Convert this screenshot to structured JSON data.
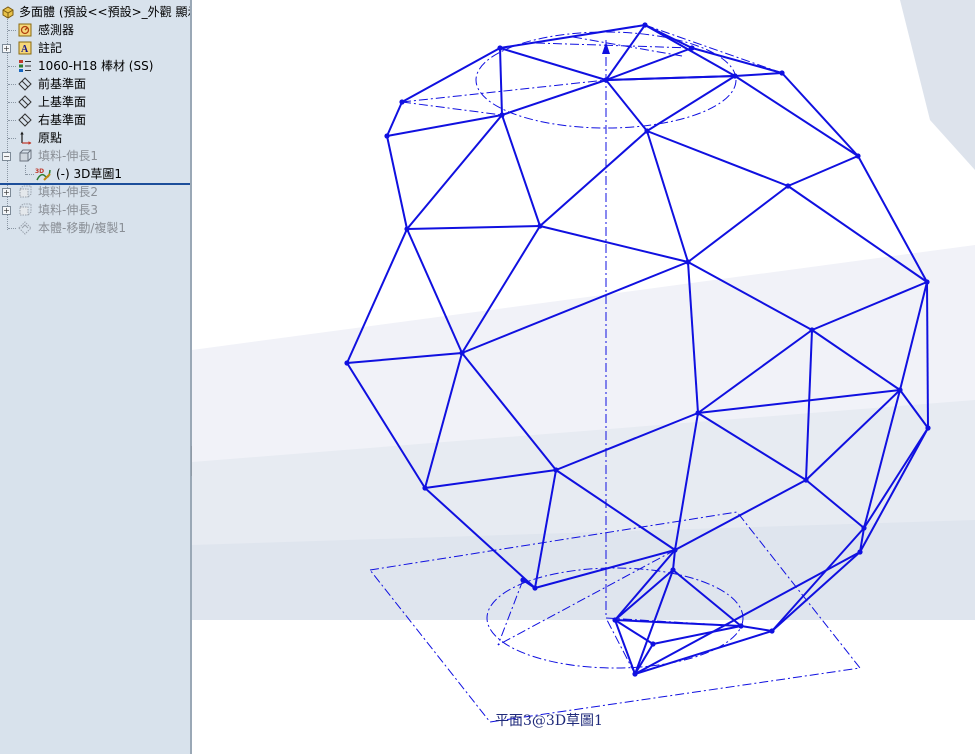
{
  "feature_tree": {
    "part_name": "多面體 (預設<<預設>_外觀 顯示",
    "items": [
      {
        "label": "感測器",
        "icon": "sensor-icon"
      },
      {
        "label": "註記",
        "icon": "annotations-icon"
      },
      {
        "label": "1060-H18 棒材 (SS)",
        "icon": "material-icon"
      },
      {
        "label": "前基準面",
        "icon": "plane-icon"
      },
      {
        "label": "上基準面",
        "icon": "plane-icon"
      },
      {
        "label": "右基準面",
        "icon": "plane-icon"
      },
      {
        "label": "原點",
        "icon": "origin-icon"
      },
      {
        "label": "填料-伸長1",
        "icon": "extrude-icon"
      },
      {
        "label": "(-) 3D草圖1",
        "icon": "3d-sketch-icon"
      },
      {
        "label": "填料-伸長2",
        "icon": "extrude-icon"
      },
      {
        "label": "填料-伸長3",
        "icon": "extrude-icon"
      },
      {
        "label": "本體-移動/複製1",
        "icon": "move-copy-icon"
      }
    ]
  },
  "graphics": {
    "plane_label": "平面3@3D草圖1",
    "sketch_color": "#1010e0"
  }
}
